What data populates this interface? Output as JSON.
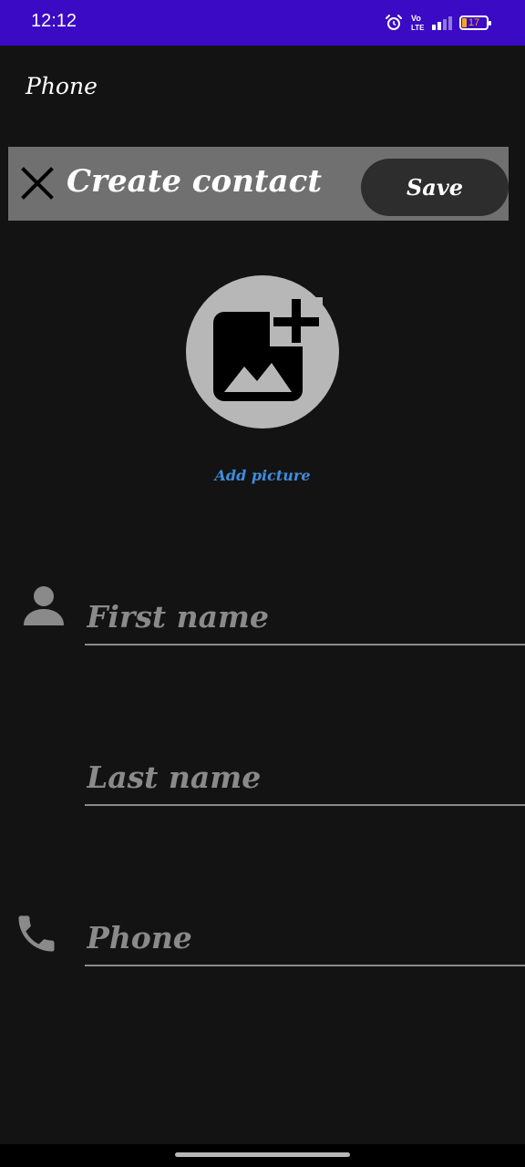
{
  "status_bar": {
    "time": "12:12",
    "battery": "17",
    "network_label": "Vo LTE",
    "icons": [
      "alarm-icon",
      "volte-icon",
      "signal-icon",
      "battery-icon"
    ]
  },
  "app_title": "Phone",
  "toolbar": {
    "title": "Create contact",
    "save_label": "Save",
    "close_icon": "close-icon"
  },
  "avatar": {
    "icon": "add-photo-icon",
    "add_picture_label": "Add picture"
  },
  "form": {
    "first_name": {
      "placeholder": "First name",
      "value": "",
      "icon": "person-icon"
    },
    "last_name": {
      "placeholder": "Last name",
      "value": ""
    },
    "phone": {
      "placeholder": "Phone",
      "value": "",
      "icon": "phone-icon"
    }
  },
  "colors": {
    "status_bar": "#3a0ac4",
    "background": "#131313",
    "toolbar": "#707070",
    "save_button": "#2d2d2d",
    "accent_link": "#3d8ede",
    "placeholder": "#8a8a8a"
  }
}
